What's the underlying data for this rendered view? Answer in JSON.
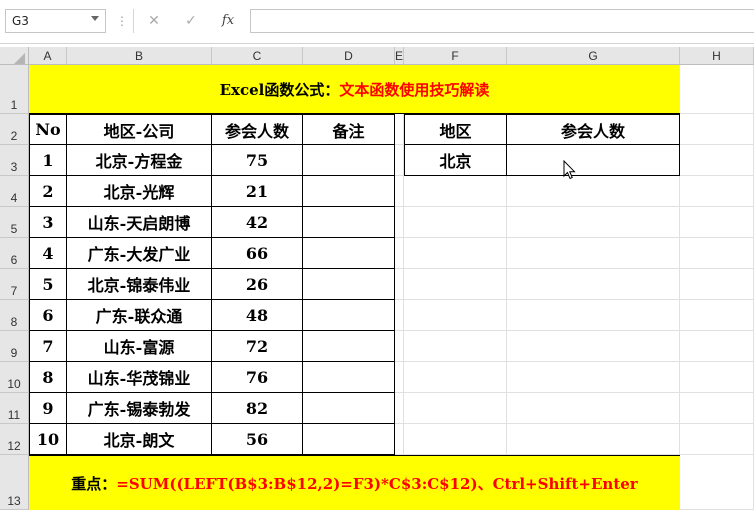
{
  "formula_bar": {
    "name_box": "G3",
    "cancel_icon": "✕",
    "enter_icon": "✓",
    "fx_label": "fx",
    "formula": ""
  },
  "columns": [
    "A",
    "B",
    "C",
    "D",
    "E",
    "F",
    "G",
    "H"
  ],
  "rows": [
    "1",
    "2",
    "3",
    "4",
    "5",
    "6",
    "7",
    "8",
    "9",
    "10",
    "11",
    "12",
    "13"
  ],
  "title": {
    "prefix": "Excel函数公式：",
    "highlight": "文本函数使用技巧解读"
  },
  "table": {
    "headers": [
      "No",
      "地区-公司",
      "参会人数",
      "备注"
    ],
    "rows": [
      {
        "no": "1",
        "company": "北京-方程金",
        "count": "75",
        "note": ""
      },
      {
        "no": "2",
        "company": "北京-光辉",
        "count": "21",
        "note": ""
      },
      {
        "no": "3",
        "company": "山东-天启朗博",
        "count": "42",
        "note": ""
      },
      {
        "no": "4",
        "company": "广东-大发广业",
        "count": "66",
        "note": ""
      },
      {
        "no": "5",
        "company": "北京-锦泰伟业",
        "count": "26",
        "note": ""
      },
      {
        "no": "6",
        "company": "广东-联众通",
        "count": "48",
        "note": ""
      },
      {
        "no": "7",
        "company": "山东-富源",
        "count": "72",
        "note": ""
      },
      {
        "no": "8",
        "company": "山东-华茂锦业",
        "count": "76",
        "note": ""
      },
      {
        "no": "9",
        "company": "广东-锡泰勃发",
        "count": "82",
        "note": ""
      },
      {
        "no": "10",
        "company": "北京-朗文",
        "count": "56",
        "note": ""
      }
    ]
  },
  "lookup": {
    "headers": [
      "地区",
      "参会人数"
    ],
    "region": "北京",
    "result": ""
  },
  "footer": {
    "label": "重点：",
    "formula": "=SUM((LEFT(B$3:B$12,2)=F3)*C$3:C$12)、Ctrl+Shift+Enter"
  },
  "colors": {
    "yellow": "#ffff00",
    "red": "#ff0000"
  }
}
